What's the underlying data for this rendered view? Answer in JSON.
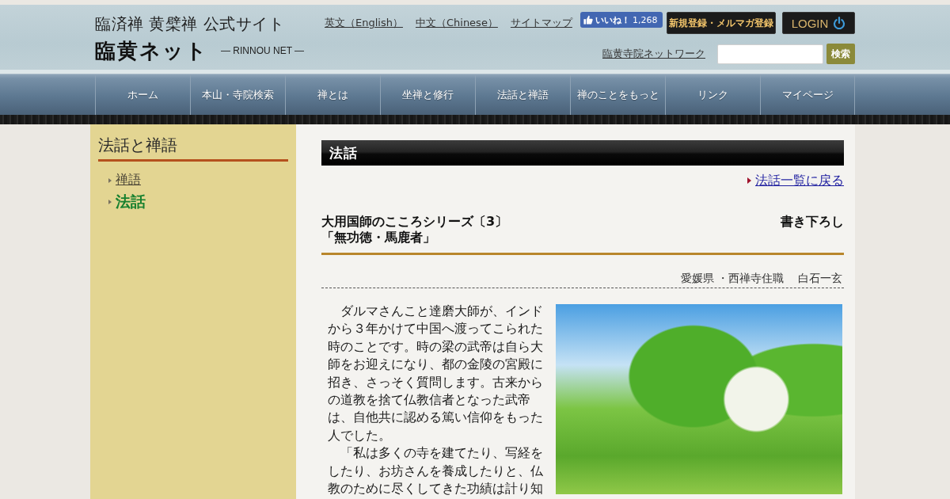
{
  "header": {
    "site_title": "臨済禅 黄檗禅 公式サイト",
    "logo_text": "臨黄ネット",
    "logo_subtitle": "— RINNOU NET —",
    "links": [
      "英文（English）",
      "中文（Chinese）",
      "サイトマップ"
    ],
    "like_button": {
      "label": "いいね！",
      "count": "1,268"
    },
    "register_button": "新規登録・メルマガ登録",
    "login_button": "LOGIN",
    "network_link": "臨黄寺院ネットワーク",
    "search": {
      "button": "検索"
    }
  },
  "nav": [
    "ホーム",
    "本山・寺院検索",
    "禅とは",
    "坐禅と修行",
    "法話と禅語",
    "禅のことをもっと",
    "リンク",
    "マイページ"
  ],
  "sidebar": {
    "title": "法話と禅語",
    "items": [
      {
        "label": "禅語",
        "selected": false
      },
      {
        "label": "法話",
        "selected": true
      }
    ]
  },
  "content": {
    "section_title": "法話",
    "back_link": "法話一覧に戻る",
    "article": {
      "title_lines": [
        "大用国師のこころシリーズ〔3〕",
        "「無功徳・馬鹿者」"
      ],
      "tag": "書き下ろし",
      "author_affiliation": "愛媛県 ・西禅寺住職",
      "author_name": "白石一玄",
      "paragraphs": [
        "ダルマさんこと達磨大師が、インドから３年かけて中国へ渡ってこられた時のことです。時の梁の武帝は自ら大師をお迎えになり、都の金陵の宮殿に招き、さっそく質問します。古来からの道教を捨て仏教信者となった武帝は、自他共に認める篤い信仰をもった人でした。",
        "「私は多くの寺を建てたり、写経をしたり、お坊さんを養成したりと、仏教のために尽くしてきた功績は計り知"
      ]
    }
  }
}
